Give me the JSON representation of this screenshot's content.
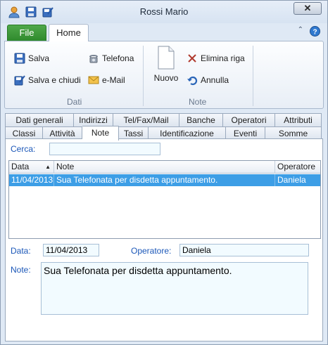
{
  "window": {
    "title": "Rossi Mario",
    "close_label": "✕"
  },
  "ribbon": {
    "tabs": {
      "file": "File",
      "home": "Home"
    },
    "groups": {
      "dati": {
        "label": "Dati",
        "salva": "Salva",
        "salva_chiudi": "Salva e chiudi",
        "telefona": "Telefona",
        "email": "e-Mail"
      },
      "note": {
        "label": "Note",
        "nuovo": "Nuovo",
        "elimina_riga": "Elimina riga",
        "annulla": "Annulla"
      }
    }
  },
  "tabs": {
    "row1": [
      "Dati generali",
      "Indirizzi",
      "Tel/Fax/Mail",
      "Banche",
      "Operatori",
      "Attributi"
    ],
    "row2": [
      "Classi",
      "Attività",
      "Note",
      "Tassi",
      "Identificazione",
      "Eventi",
      "Somme"
    ],
    "active": "Note"
  },
  "search": {
    "label": "Cerca:",
    "value": ""
  },
  "grid": {
    "columns": [
      "Data",
      "Note",
      "Operatore"
    ],
    "rows": [
      {
        "data": "11/04/2013",
        "note": "Sua Telefonata per disdetta appuntamento.",
        "operatore": "Daniela"
      }
    ]
  },
  "detail": {
    "data_label": "Data:",
    "data_value": "11/04/2013",
    "operatore_label": "Operatore:",
    "operatore_value": "Daniela",
    "note_label": "Note:",
    "note_value": "Sua Telefonata per disdetta appuntamento."
  },
  "colors": {
    "selection": "#3d9ee6",
    "file_tab": "#3a9637",
    "label_blue": "#1b57b8"
  }
}
